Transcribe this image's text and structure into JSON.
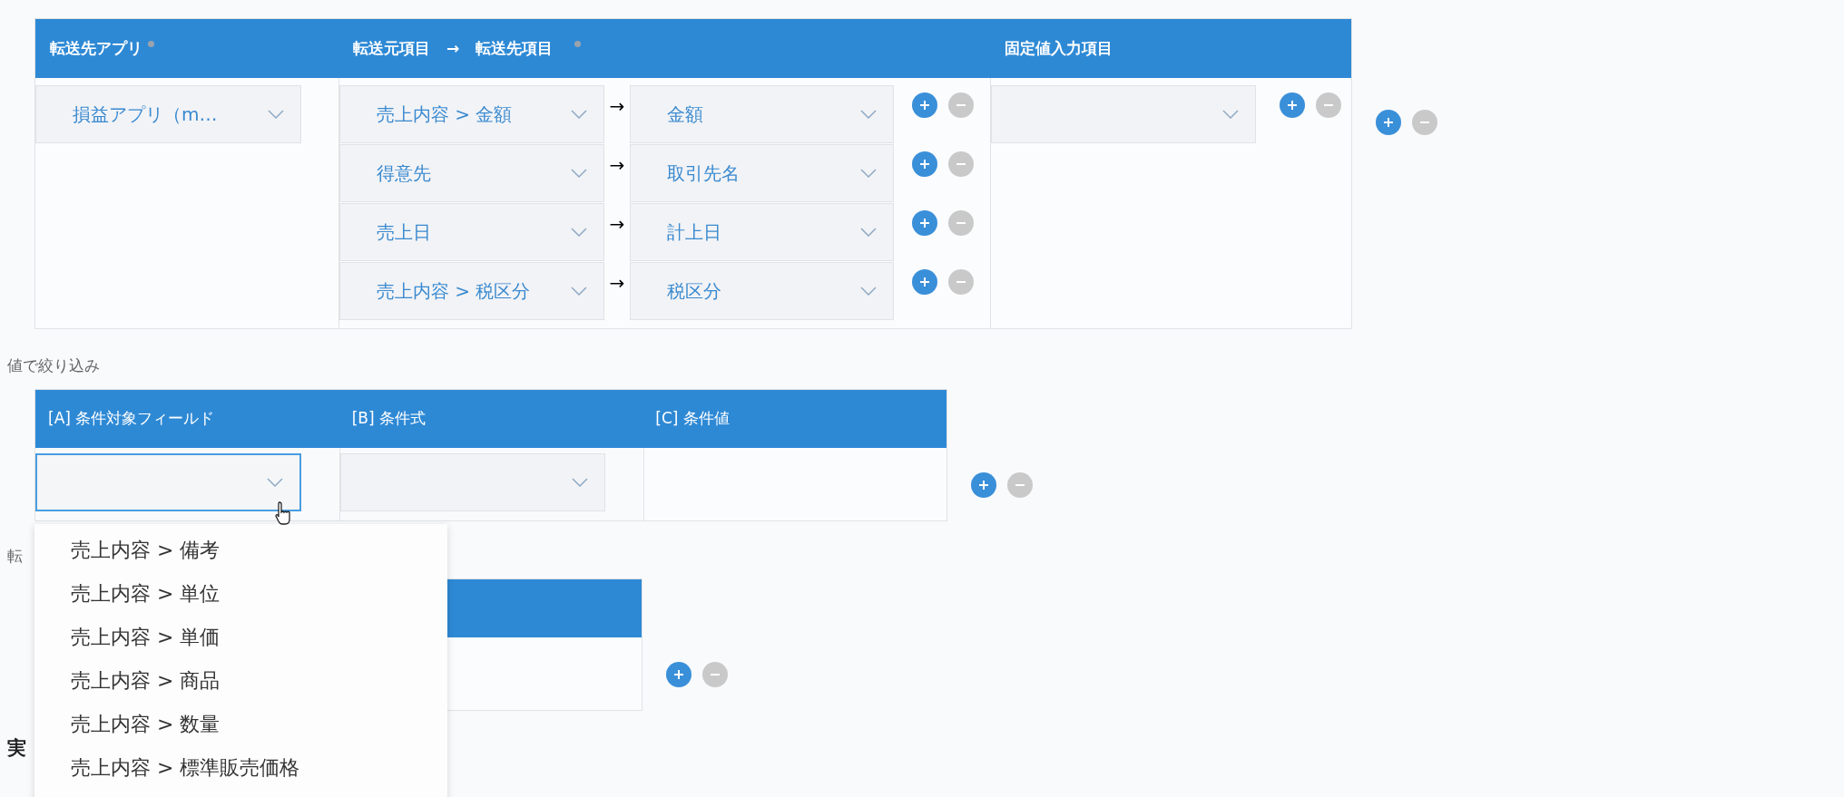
{
  "mapping": {
    "columns": [
      {
        "label": "転送先アプリ",
        "required": true
      },
      {
        "label": "転送元項目",
        "arrow": "→",
        "label2": "転送先項目",
        "required": true
      },
      {
        "label": "固定値入力項目",
        "required": false
      }
    ],
    "app": {
      "value": "損益アプリ（m…"
    },
    "rows": [
      {
        "source": "売上内容 > 金額",
        "arrow": "→",
        "target": "金額",
        "remove_disabled": true
      },
      {
        "source": "得意先",
        "arrow": "→",
        "target": "取引先名",
        "remove_disabled": true
      },
      {
        "source": "売上日",
        "arrow": "→",
        "target": "計上日",
        "remove_disabled": true
      },
      {
        "source": "売上内容 > 税区分",
        "arrow": "→",
        "target": "税区分",
        "remove_disabled": true
      }
    ],
    "fixed_inputs": [
      {
        "kind": "select",
        "remove_disabled": true
      }
    ],
    "section_remove_disabled": true
  },
  "filter": {
    "title": "値で絞り込み",
    "columns": [
      "[A] 条件対象フィールド",
      "[B] 条件式",
      "[C] 条件値"
    ],
    "field_focused": true,
    "remove_disabled": true,
    "options": [
      "売上内容 > 備考",
      "売上内容 > 単位",
      "売上内容 > 単価",
      "売上内容 > 商品",
      "売上内容 > 数量",
      "売上内容 > 標準販売価格"
    ]
  },
  "third": {
    "title": "転",
    "remove_disabled": true
  },
  "next_heading": "実"
}
